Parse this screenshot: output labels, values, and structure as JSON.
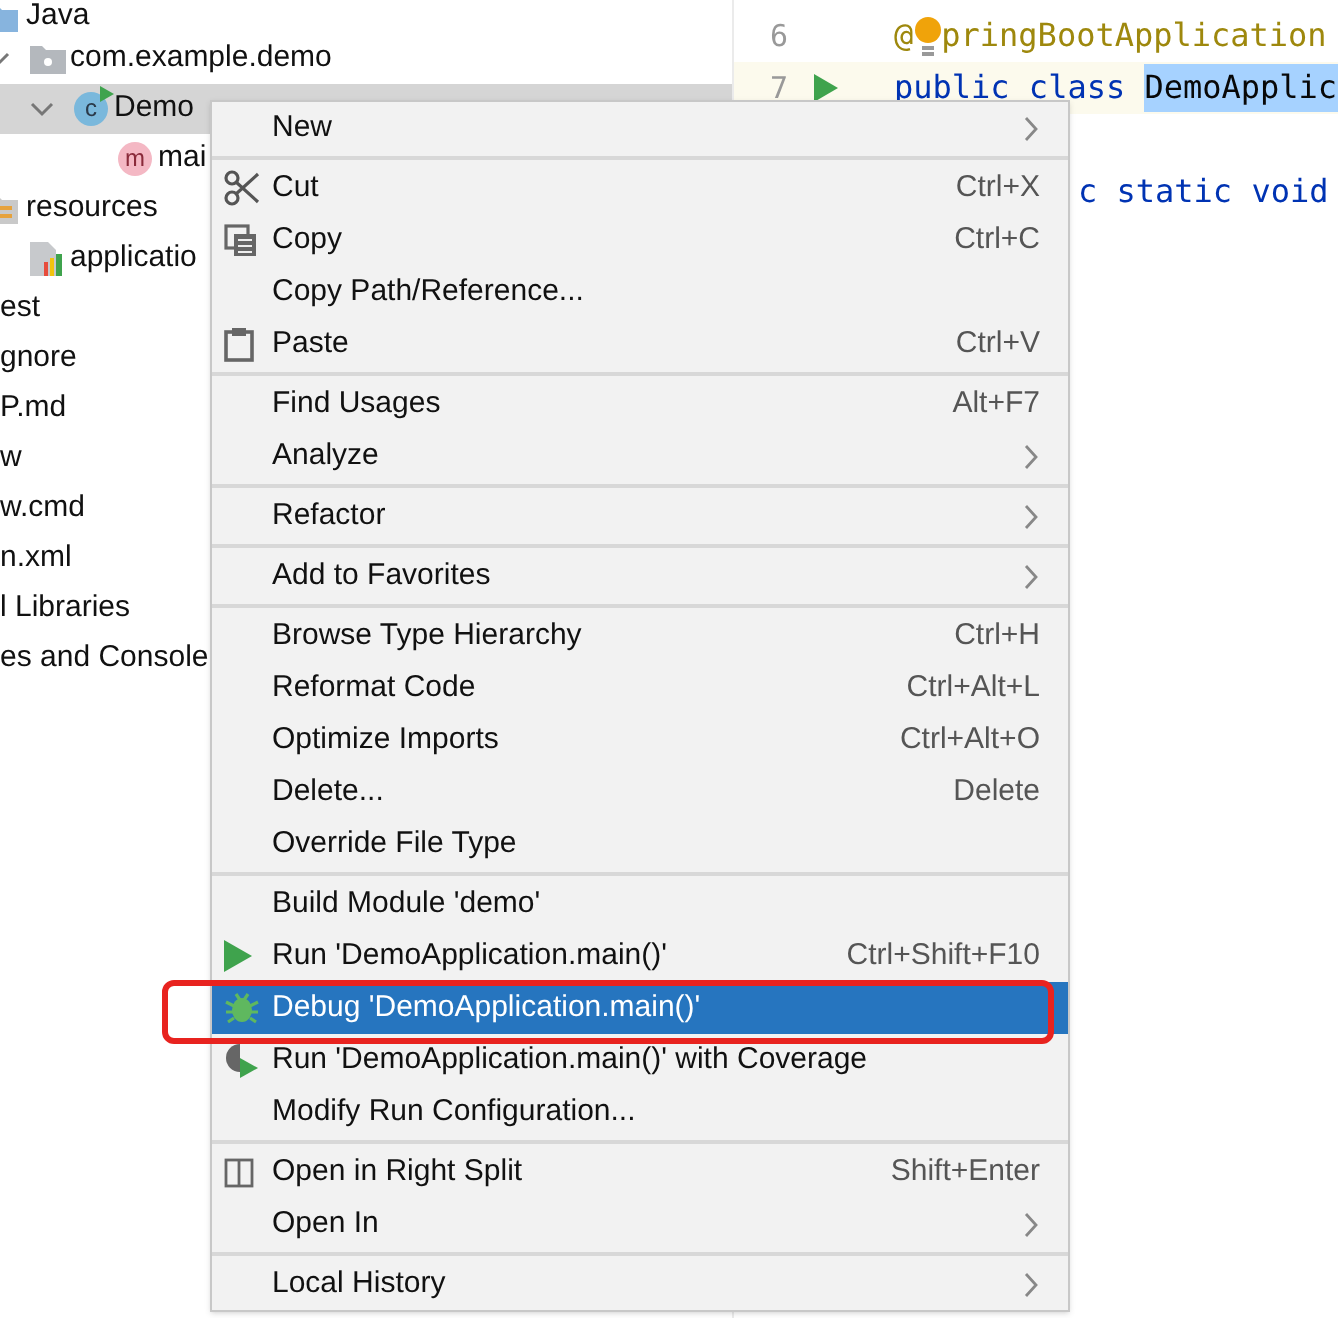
{
  "project_tree": [
    {
      "label": "Java",
      "kind": "folder",
      "selected": false,
      "children": [
        {
          "label": "com.example.demo",
          "kind": "package",
          "expanded": true,
          "selected": false,
          "children": [
            {
              "label": "Demo",
              "kind": "class",
              "badge": "c",
              "expanded": true,
              "selected": true,
              "children": [
                {
                  "label": "mai",
                  "kind": "method",
                  "badge": "m",
                  "expanded": false,
                  "selected": false
                }
              ]
            }
          ]
        }
      ]
    },
    {
      "label": "resources",
      "kind": "resources",
      "selected": false,
      "children": [
        {
          "label": "applicatio",
          "kind": "config",
          "expanded": false,
          "selected": false
        }
      ]
    },
    {
      "label": "est",
      "kind": "none",
      "selected": false
    },
    {
      "label": "gnore",
      "kind": "none",
      "selected": false
    },
    {
      "label": "P.md",
      "kind": "none",
      "selected": false
    },
    {
      "label": "w",
      "kind": "none",
      "selected": false
    },
    {
      "label": "w.cmd",
      "kind": "none",
      "selected": false
    },
    {
      "label": "n.xml",
      "kind": "none",
      "selected": false
    },
    {
      "label": "l Libraries",
      "kind": "none",
      "selected": false
    },
    {
      "label": "es and Console",
      "kind": "none",
      "selected": false
    }
  ],
  "editor": {
    "lines": [
      {
        "number": "6",
        "current": false,
        "run": false,
        "bulb": true,
        "segments": [
          {
            "text": "@",
            "kind": "annotation"
          },
          {
            "text": "pringBootApplication",
            "kind": "annotation"
          }
        ]
      },
      {
        "number": "7",
        "current": true,
        "run": true,
        "bulb": false,
        "segments": [
          {
            "text": "public class ",
            "kind": "keyword"
          },
          {
            "text": "DemoApplic",
            "kind": "selection"
          }
        ]
      },
      {
        "current": false
      },
      {
        "current": false,
        "segments": [
          {
            "text": "c static void",
            "kind": "keyword"
          }
        ]
      }
    ]
  },
  "context_menu": {
    "groups": [
      [
        {
          "label": "New",
          "kind": "plain",
          "submenu": true,
          "selected": false,
          "outlined": false
        }
      ],
      [
        {
          "label": "Cut",
          "kind": "cut",
          "shortcut": "Ctrl+X",
          "submenu": false,
          "selected": false,
          "outlined": false
        },
        {
          "label": "Copy",
          "kind": "copy",
          "shortcut": "Ctrl+C",
          "submenu": false,
          "selected": false,
          "outlined": false
        },
        {
          "label": "Copy Path/Reference...",
          "kind": "plain",
          "submenu": false,
          "selected": false,
          "outlined": false
        },
        {
          "label": "Paste",
          "kind": "paste",
          "shortcut": "Ctrl+V",
          "submenu": false,
          "selected": false,
          "outlined": false
        }
      ],
      [
        {
          "label": "Find Usages",
          "kind": "plain",
          "shortcut": "Alt+F7",
          "submenu": false,
          "selected": false,
          "outlined": false
        },
        {
          "label": "Analyze",
          "kind": "plain",
          "submenu": true,
          "selected": false,
          "outlined": false
        }
      ],
      [
        {
          "label": "Refactor",
          "kind": "plain",
          "submenu": true,
          "selected": false,
          "outlined": false
        }
      ],
      [
        {
          "label": "Add to Favorites",
          "kind": "plain",
          "submenu": true,
          "selected": false,
          "outlined": false
        }
      ],
      [
        {
          "label": "Browse Type Hierarchy",
          "kind": "plain",
          "shortcut": "Ctrl+H",
          "submenu": false,
          "selected": false,
          "outlined": false
        },
        {
          "label": "Reformat Code",
          "kind": "plain",
          "shortcut": "Ctrl+Alt+L",
          "submenu": false,
          "selected": false,
          "outlined": false
        },
        {
          "label": "Optimize Imports",
          "kind": "plain",
          "shortcut": "Ctrl+Alt+O",
          "submenu": false,
          "selected": false,
          "outlined": false
        },
        {
          "label": "Delete...",
          "kind": "plain",
          "shortcut": "Delete",
          "submenu": false,
          "selected": false,
          "outlined": false
        },
        {
          "label": "Override File Type",
          "kind": "plain",
          "submenu": false,
          "selected": false,
          "outlined": false
        }
      ],
      [
        {
          "label": "Build Module 'demo'",
          "kind": "plain",
          "submenu": false,
          "selected": false,
          "outlined": false
        },
        {
          "label": "Run 'DemoApplication.main()'",
          "kind": "run",
          "shortcut": "Ctrl+Shift+F10",
          "submenu": false,
          "selected": false,
          "outlined": false
        },
        {
          "label": "Debug 'DemoApplication.main()'",
          "kind": "debug",
          "submenu": false,
          "selected": true,
          "outlined": true
        },
        {
          "label": "Run 'DemoApplication.main()' with Coverage",
          "kind": "coverage",
          "submenu": false,
          "selected": false,
          "outlined": false
        },
        {
          "label": "Modify Run Configuration...",
          "kind": "plain",
          "submenu": false,
          "selected": false,
          "outlined": false
        }
      ],
      [
        {
          "label": "Open in Right Split",
          "kind": "split",
          "shortcut": "Shift+Enter",
          "submenu": false,
          "selected": false,
          "outlined": false
        },
        {
          "label": "Open In",
          "kind": "plain",
          "submenu": true,
          "selected": false,
          "outlined": false
        }
      ],
      [
        {
          "label": "Local History",
          "kind": "plain",
          "submenu": true,
          "selected": false,
          "outlined": false
        }
      ]
    ]
  }
}
